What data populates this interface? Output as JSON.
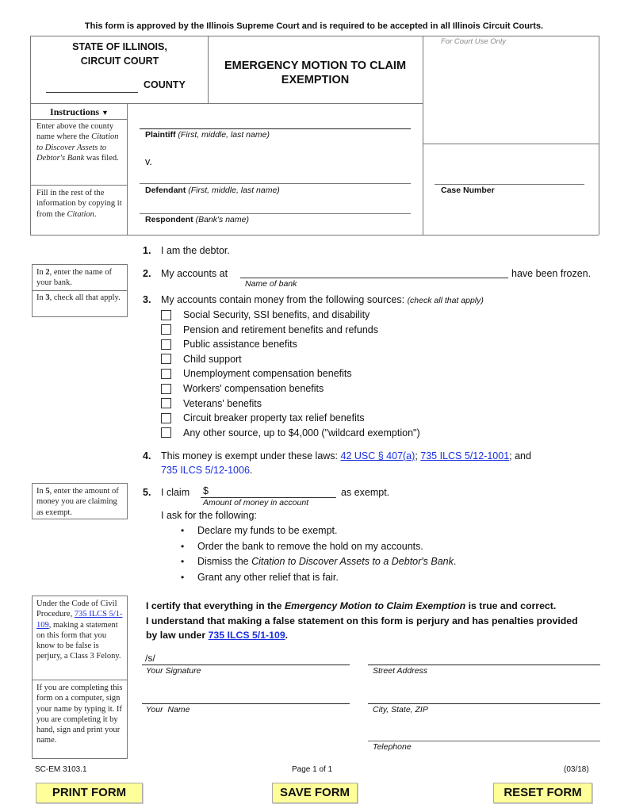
{
  "top_notice": "This form is approved by the Illinois Supreme Court and is required to be accepted in all Illinois Circuit Courts.",
  "header": {
    "state_line1": "STATE OF ILLINOIS,",
    "state_line2": "CIRCUIT COURT",
    "county_label": "COUNTY",
    "county_value": "",
    "title_line1": "EMERGENCY MOTION TO CLAIM",
    "title_line2": "EXEMPTION",
    "court_use": "For Court Use Only"
  },
  "instructions": {
    "heading": "Instructions",
    "box1": {
      "t1": "Enter above the county name where the ",
      "i1": "Citation to Discover Assets to Debtor's Bank",
      "t2": " was filed."
    },
    "box2": {
      "t1": "Fill in the rest of the information by copying it from the ",
      "i1": "Citation",
      "t2": "."
    },
    "box3": {
      "pre": "In ",
      "b": "2",
      "post": ", enter the name of your bank."
    },
    "box4": {
      "pre": "In ",
      "b": "3",
      "post": ", check all that apply."
    },
    "box5": {
      "pre": "In ",
      "b": "5",
      "post": ", enter the amount of money you are claiming as exempt."
    },
    "box6": {
      "t1": "Under the Code of Civil Procedure, ",
      "link": "735 ILCS 5/1-109",
      "t2": ", making a statement on this form that you know to be false is perjury, a Class 3 Felony."
    },
    "box7": "If you are completing this form on a computer, sign your name by typing it.  If you are completing it by hand, sign and print your name."
  },
  "parties": {
    "plaintiff_label": "Plaintiff",
    "plaintiff_hint": "(First, middle, last name)",
    "plaintiff_value": "",
    "versus": "v.",
    "defendant_label": "Defendant",
    "defendant_hint": "(First, middle, last name)",
    "defendant_value": "",
    "respondent_label": "Respondent",
    "respondent_hint": "(Bank's name)",
    "respondent_value": "",
    "case_number_label": "Case Number",
    "case_number_value": ""
  },
  "items": {
    "i1": {
      "num": "1.",
      "text": "I am the debtor."
    },
    "i2": {
      "num": "2.",
      "pre": "My accounts at",
      "post": "have been frozen.",
      "field_caption": "Name of bank",
      "value": ""
    },
    "i3": {
      "num": "3.",
      "text": "My accounts contain money from the following sources: ",
      "hint": "(check all that apply)",
      "options": [
        {
          "label": "Social Security, SSI benefits, and disability",
          "checked": false
        },
        {
          "label": "Pension and retirement benefits and refunds",
          "checked": false
        },
        {
          "label": "Public assistance benefits",
          "checked": false
        },
        {
          "label": "Child support",
          "checked": false
        },
        {
          "label": "Unemployment compensation benefits",
          "checked": false
        },
        {
          "label": "Workers' compensation benefits",
          "checked": false
        },
        {
          "label": "Veterans' benefits",
          "checked": false
        },
        {
          "label": "Circuit breaker property tax relief benefits",
          "checked": false
        },
        {
          "label": "Any other source, up to $4,000 (\"wildcard exemption\")",
          "checked": false
        }
      ]
    },
    "i4": {
      "num": "4.",
      "text": "This money is exempt under these laws:  ",
      "link1": "42 USC § 407(a)",
      "sep1": "; ",
      "link2": "735 ILCS 5/12-1001",
      "sep2": "; and",
      "link3": "735 ILCS 5/12-1006",
      "end": "."
    },
    "i5": {
      "num": "5.",
      "pre": "I claim",
      "dollar": "$",
      "post": "as exempt.",
      "field_caption": "Amount of money in account",
      "value": "",
      "ask": "I ask for the following:",
      "requests": [
        {
          "text": "Declare my funds to be exempt."
        },
        {
          "text": "Order the bank to remove the hold on my accounts."
        },
        {
          "pre": "Dismiss the ",
          "ital": "Citation to Discover Assets to a Debtor's Bank",
          "post": "."
        },
        {
          "text": "Grant any other relief that is fair."
        }
      ]
    }
  },
  "certify": {
    "l1_pre": "I certify that everything in the ",
    "l1_ital": "Emergency Motion to Claim Exemption",
    "l1_post": " is true and correct.",
    "l2": "I understand that making a false statement on this form is perjury and has penalties provided",
    "l3_pre": "by law under ",
    "l3_link": "735 ILCS 5/1-109",
    "l3_post": "."
  },
  "signature": {
    "sig_value": "/s/",
    "sig_label": "Your Signature",
    "name_label": "Your  Name",
    "street_label": "Street Address",
    "city_label": "City, State, ZIP",
    "phone_label": "Telephone"
  },
  "footer": {
    "form_id": "SC-EM 3103.1",
    "page": "Page 1 of 1",
    "revision": "(03/18)"
  },
  "buttons": {
    "print": "PRINT FORM",
    "save": "SAVE FORM",
    "reset": "RESET FORM"
  }
}
